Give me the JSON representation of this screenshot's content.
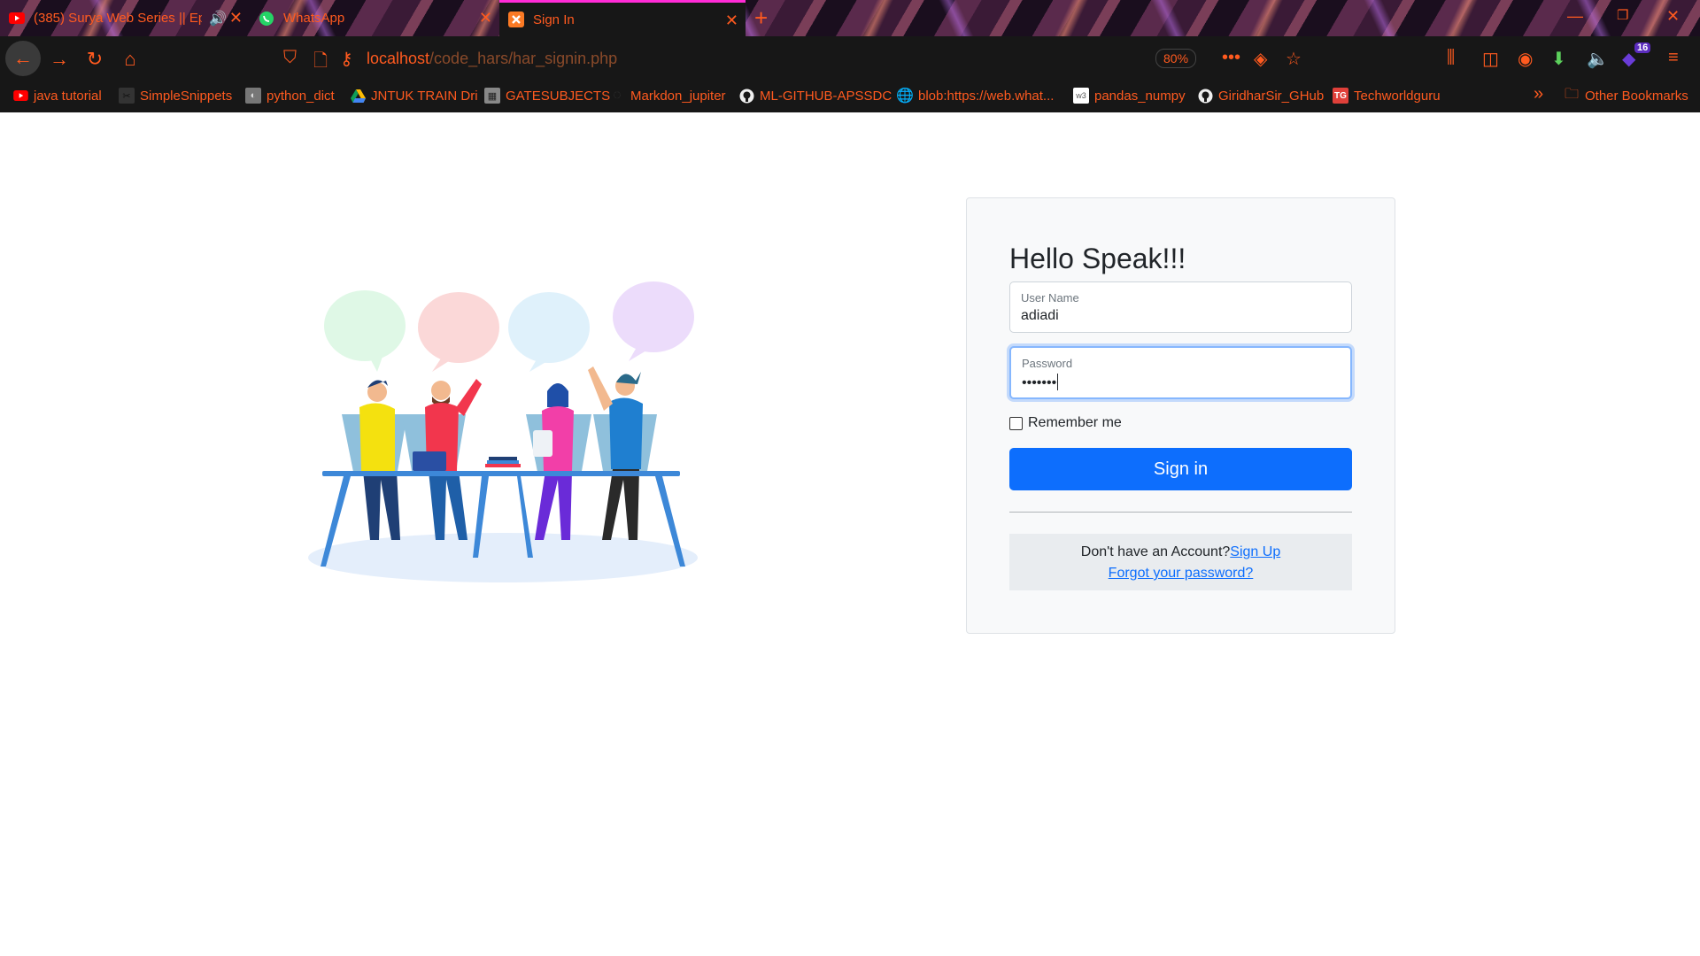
{
  "browser": {
    "tabs": [
      {
        "title": "(385) Surya Web Series || Ep",
        "favicon": "youtube-icon",
        "audio": true
      },
      {
        "title": "WhatsApp",
        "favicon": "whatsapp-icon"
      },
      {
        "title": "Sign In",
        "favicon": "xampp-icon",
        "active": true
      }
    ],
    "url_host": "localhost",
    "url_path": "/code_hars/har_signin.php",
    "zoom": "80%",
    "extension_badge": "16",
    "bookmarks": [
      {
        "label": "java tutorial",
        "icon": "youtube-icon"
      },
      {
        "label": "SimpleSnippets",
        "icon": "snippets-icon"
      },
      {
        "label": "python_dict",
        "icon": "image-icon"
      },
      {
        "label": "JNTUK TRAIN Dri",
        "icon": "google-drive-icon"
      },
      {
        "label": "GATESUBJECTS",
        "icon": "image-icon"
      },
      {
        "label": "Markdon_jupiter",
        "icon": "jupyter-icon"
      },
      {
        "label": "ML-GITHUB-APSSDC",
        "icon": "github-icon"
      },
      {
        "label": "blob:https://web.what...",
        "icon": "globe-icon"
      },
      {
        "label": "pandas_numpy",
        "icon": "w3schools-icon"
      },
      {
        "label": "GiridharSir_GHub",
        "icon": "github-icon"
      },
      {
        "label": "Techworldguru",
        "icon": "tg-icon"
      }
    ],
    "other_bookmarks": "Other Bookmarks",
    "accent_color": "#ff5a1f"
  },
  "signin": {
    "heading": "Hello Speak!!!",
    "username_label": "User Name",
    "username_value": "adiadi",
    "password_label": "Password",
    "password_value": "•••••••",
    "remember_label": "Remember me",
    "button_label": "Sign in",
    "no_account_text": "Don't have an Account?",
    "signup_link": "Sign Up",
    "forgot_link": "Forgot your password?",
    "primary_color": "#0d6efd"
  }
}
